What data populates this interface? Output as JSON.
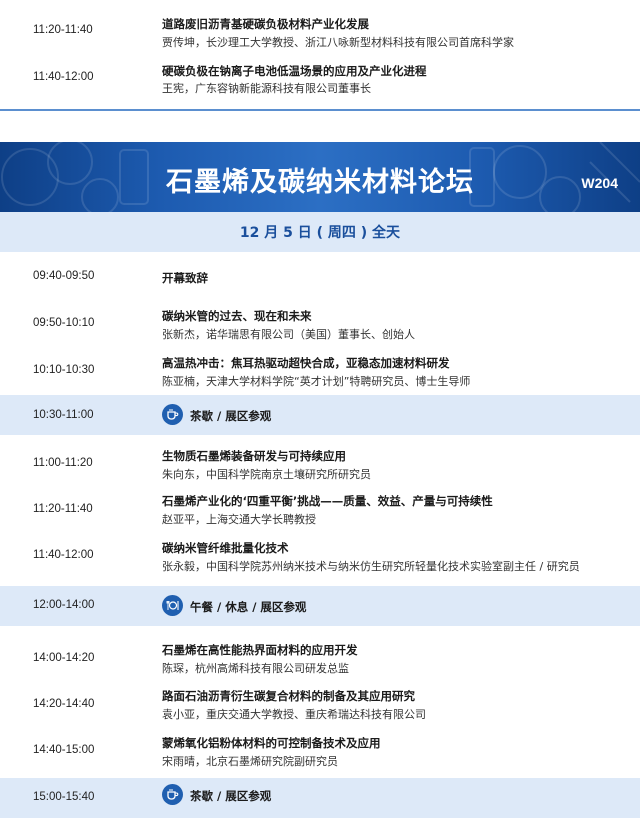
{
  "colors": {
    "accent": "#1f5fb0",
    "banner": "#1d5bb0",
    "highlight_row": "#dde9f8",
    "date_text": "#1a4f9c"
  },
  "prev_session": [
    {
      "time": "11:20-11:40",
      "title": "道路废旧沥青基硬碳负极材料产业化发展",
      "speaker": "贾传坤，长沙理工大学教授、浙江八咏新型材料科技有限公司首席科学家"
    },
    {
      "time": "11:40-12:00",
      "title": "硬碳负极在钠离子电池低温场景的应用及产业化进程",
      "speaker": "王宪，广东容钠新能源科技有限公司董事长"
    }
  ],
  "forum": {
    "title": "石墨烯及碳纳米材料论坛",
    "room": "W204",
    "date": "12 月 5 日 ( 周四 ) 全天"
  },
  "agenda": [
    {
      "time": "09:40-09:50",
      "title": "开幕致辞"
    },
    {
      "time": "09:50-10:10",
      "title": "碳纳米管的过去、现在和未来",
      "speaker": "张新杰，诺华瑞思有限公司（美国）董事长、创始人"
    },
    {
      "time": "10:10-10:30",
      "title": "高温热冲击：焦耳热驱动超快合成，亚稳态加速材料研发",
      "speaker": "陈亚楠，天津大学材料学院“英才计划”特聘研究员、博士生导师"
    },
    {
      "time": "10:30-11:00",
      "break": "茶歇 / 展区参观",
      "icon": "coffee-cup-icon"
    },
    {
      "time": "11:00-11:20",
      "title": "生物质石墨烯装备研发与可持续应用",
      "speaker": "朱向东，中国科学院南京土壤研究所研究员"
    },
    {
      "time": "11:20-11:40",
      "title": "石墨烯产业化的‘四重平衡’挑战——质量、效益、产量与可持续性",
      "speaker": "赵亚平，上海交通大学长聘教授"
    },
    {
      "time": "11:40-12:00",
      "title": "碳纳米管纤维批量化技术",
      "speaker": "张永毅，中国科学院苏州纳米技术与纳米仿生研究所轻量化技术实验室副主任 / 研究员"
    },
    {
      "time": "12:00-14:00",
      "break": "午餐 / 休息 / 展区参观",
      "icon": "meal-plate-icon"
    },
    {
      "time": "14:00-14:20",
      "title": "石墨烯在高性能热界面材料的应用开发",
      "speaker": "陈琛，杭州高烯科技有限公司研发总监"
    },
    {
      "time": "14:20-14:40",
      "title": "路面石油沥青衍生碳复合材料的制备及其应用研究",
      "speaker": "袁小亚，重庆交通大学教授、重庆希瑞达科技有限公司"
    },
    {
      "time": "14:40-15:00",
      "title": "蒙烯氧化铝粉体材料的可控制备技术及应用",
      "speaker": "宋雨晴，北京石墨烯研究院副研究员"
    },
    {
      "time": "15:00-15:40",
      "break": "茶歇 / 展区参观",
      "icon": "coffee-cup-icon"
    }
  ]
}
